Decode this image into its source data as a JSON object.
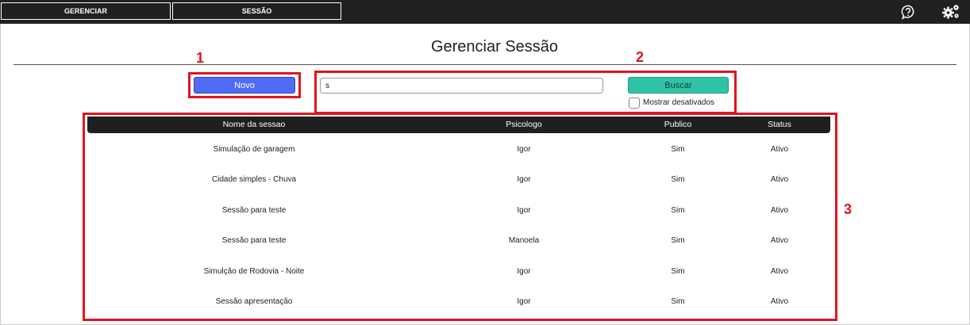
{
  "topbar": {
    "tabs": [
      "GERENCIAR",
      "SESSÃO"
    ],
    "icons": [
      "help-icon",
      "settings-gears-icon"
    ]
  },
  "page": {
    "title": "Gerenciar Sessão"
  },
  "toolbar": {
    "new_label": "Novo",
    "search_value": "s",
    "search_label": "Buscar",
    "show_disabled_label": "Mostrar desativados",
    "show_disabled_checked": false
  },
  "annotations": {
    "labels": [
      "1",
      "2",
      "3"
    ],
    "color": "#e0141e"
  },
  "table": {
    "headers": [
      "Nome da sessao",
      "Psicologo",
      "Publico",
      "Status"
    ],
    "rows": [
      [
        "Simulação de garagem",
        "Igor",
        "Sim",
        "Ativo"
      ],
      [
        "Cidade simples - Chuva",
        "Igor",
        "Sim",
        "Ativo"
      ],
      [
        "Sessão para teste",
        "Igor",
        "Sim",
        "Ativo"
      ],
      [
        "Sessão para teste",
        "Manoela",
        "Sim",
        "Ativo"
      ],
      [
        "Simulção de Rodovia - Noite",
        "Igor",
        "Sim",
        "Ativo"
      ],
      [
        "Sessão apresentação",
        "Igor",
        "Sim",
        "Ativo"
      ]
    ]
  },
  "colors": {
    "topbar": "#202020",
    "new_button": "#4f6cf7",
    "search_button": "#2fc3a6",
    "table_header": "#1f1f1f"
  }
}
